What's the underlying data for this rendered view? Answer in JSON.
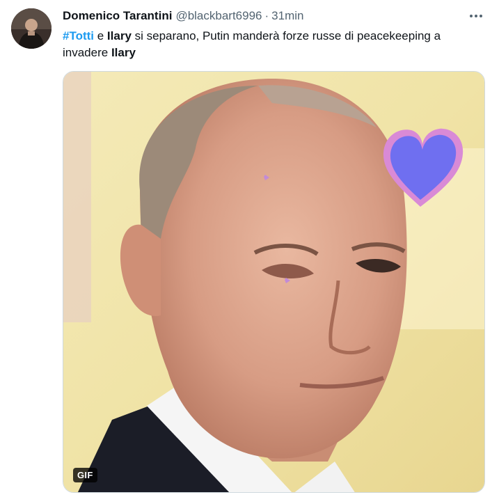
{
  "tweet": {
    "display_name": "Domenico Tarantini",
    "handle": "@blackbart6996",
    "separator": "·",
    "time": "31min",
    "text": {
      "hashtag": "#Totti",
      "t1": " e ",
      "bold1": "Ilary",
      "t2": " si separano, Putin manderà forze russe di peacekeeping a invadere ",
      "bold2": "Ilary"
    },
    "media": {
      "badge": "GIF"
    },
    "icons": {
      "avatar": "avatar",
      "more": "more-icon",
      "heart": "heart-sticker-icon"
    },
    "colors": {
      "hashtag": "#1d9bf0",
      "secondary_text": "#536471",
      "heart_fill": "#6f6ff0",
      "heart_outline": "#d98ad6"
    }
  }
}
